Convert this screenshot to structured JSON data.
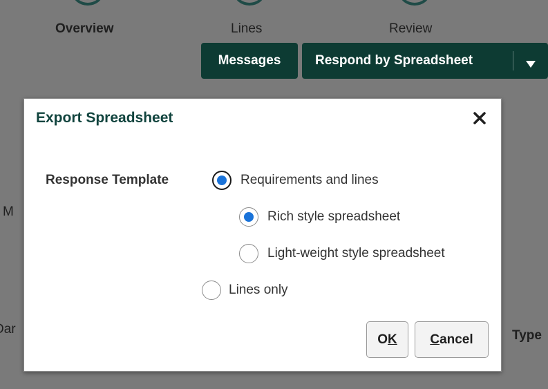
{
  "steps": [
    {
      "label": "Overview",
      "bold": true
    },
    {
      "label": "Lines"
    },
    {
      "label": "Review"
    }
  ],
  "toolbar": {
    "messages_label": "Messages",
    "respond_label": "Respond by Spreadsheet",
    "dropdown_icon": "caret-down-icon"
  },
  "background": {
    "fragment_left_1": "M",
    "fragment_left_2": "Dar",
    "fragment_right": "Type"
  },
  "dialog": {
    "title": "Export Spreadsheet",
    "close_icon": "close-icon",
    "field_label": "Response Template",
    "options": {
      "requirements_and_lines": {
        "label": "Requirements and lines",
        "checked": true
      },
      "rich_style": {
        "label": "Rich style spreadsheet",
        "checked": true
      },
      "light_weight": {
        "label": "Light-weight style spreadsheet",
        "checked": false
      },
      "lines_only": {
        "label": "Lines only",
        "checked": false
      }
    },
    "ok": {
      "mnemonic_prefix": "O",
      "mnemonic": "K",
      "suffix": ""
    },
    "cancel": {
      "mnemonic_prefix": "",
      "mnemonic": "C",
      "suffix": "ancel"
    }
  },
  "colors": {
    "overlay": "#7a7a7a",
    "accent_dark_green": "#0d3b33",
    "title_green": "#11443e",
    "radio_blue": "#1a73d9"
  }
}
